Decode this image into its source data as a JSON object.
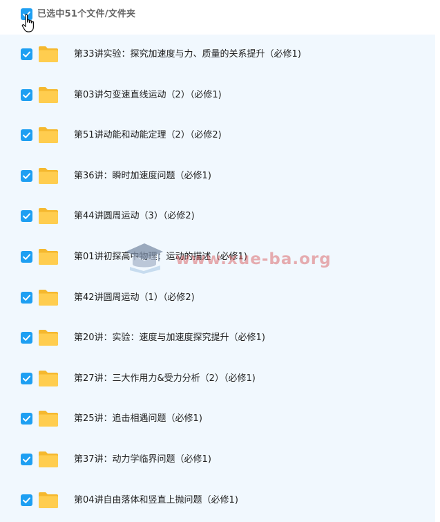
{
  "header": {
    "selection_label": "已选中51个文件/文件夹"
  },
  "colors": {
    "accent": "#1e9ff2",
    "list_bg": "#f1f8fe",
    "folder": "#ffc43d"
  },
  "icons": {
    "checkbox": "checkbox-checked-icon",
    "folder": "folder-icon",
    "cursor": "hand-pointer-icon"
  },
  "files": [
    {
      "name": "第33讲实验：探究加速度与力、质量的关系提升（必修1)",
      "checked": true
    },
    {
      "name": "第03讲匀变速直线运动（2）（必修1)",
      "checked": true
    },
    {
      "name": "第51讲动能和动能定理（2）（必修2)",
      "checked": true
    },
    {
      "name": "第36讲：瞬时加速度问题（必修1)",
      "checked": true
    },
    {
      "name": "第44讲圆周运动（3）（必修2)",
      "checked": true
    },
    {
      "name": "第01讲初探高中物理：运动的描述（必修1)",
      "checked": true
    },
    {
      "name": "第42讲圆周运动（1）（必修2)",
      "checked": true
    },
    {
      "name": "第20讲：实验：速度与加速度探究提升（必修1)",
      "checked": true
    },
    {
      "name": "第27讲：三大作用力&受力分析（2）（必修1)",
      "checked": true
    },
    {
      "name": "第25讲：追击相遇问题（必修1)",
      "checked": true
    },
    {
      "name": "第37讲：动力学临界问题（必修1)",
      "checked": true
    },
    {
      "name": "第04讲自由落体和竖直上抛问题（必修1)",
      "checked": true
    }
  ],
  "watermark": {
    "text": "www.xue-ba.org"
  }
}
